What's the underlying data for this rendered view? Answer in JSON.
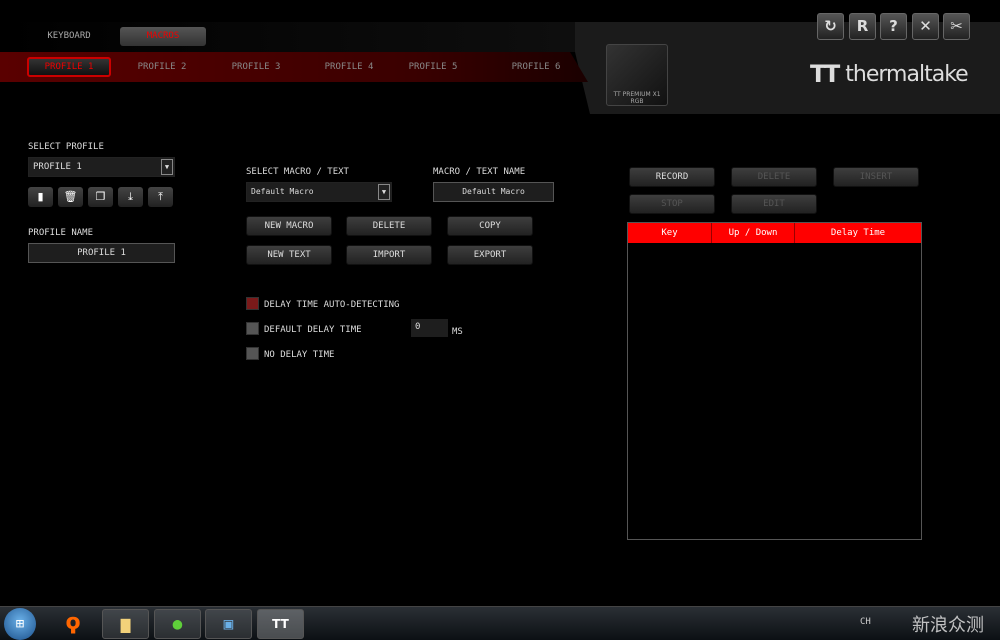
{
  "tabs": [
    {
      "label": "KEYBOARD",
      "active": false
    },
    {
      "label": "MACROS",
      "active": true
    }
  ],
  "profile_tabs": [
    "PROFILE 1",
    "PROFILE 2",
    "PROFILE 3",
    "PROFILE 4",
    "PROFILE 5",
    "PROFILE 6"
  ],
  "active_profile_tab": 0,
  "window_buttons": [
    {
      "icon": "refresh-icon",
      "glyph": "↻"
    },
    {
      "icon": "reset-icon",
      "glyph": "R"
    },
    {
      "icon": "help-icon",
      "glyph": "?"
    },
    {
      "icon": "close-icon",
      "glyph": "✕"
    },
    {
      "icon": "tools-icon",
      "glyph": "✂"
    }
  ],
  "device": {
    "name": "TT PREMIUM X1 RGB"
  },
  "brand": {
    "logo": "thermaltake"
  },
  "profile": {
    "select_label": "SELECT PROFILE",
    "selected": "PROFILE 1",
    "name_label": "PROFILE NAME",
    "name_value": "PROFILE 1",
    "actions": [
      {
        "icon": "new-icon",
        "glyph": "▮"
      },
      {
        "icon": "trash-icon",
        "glyph": "🗑"
      },
      {
        "icon": "copy-icon",
        "glyph": "❐"
      },
      {
        "icon": "import-icon",
        "glyph": "⤓"
      },
      {
        "icon": "export-icon",
        "glyph": "⤒"
      }
    ]
  },
  "macro": {
    "select_label": "SELECT MACRO / TEXT",
    "selected": "Default Macro",
    "name_label": "MACRO / TEXT NAME",
    "name_value": "Default Macro",
    "buttons": [
      "NEW MACRO",
      "DELETE",
      "COPY",
      "NEW TEXT",
      "IMPORT",
      "EXPORT"
    ],
    "options": [
      {
        "label": "DELAY TIME AUTO-DETECTING",
        "checked": true
      },
      {
        "label": "DEFAULT DELAY TIME",
        "checked": false
      },
      {
        "label": "NO DELAY TIME",
        "checked": false
      }
    ],
    "delay_value": "0",
    "delay_unit": "MS"
  },
  "record": {
    "buttons": [
      {
        "label": "RECORD",
        "enabled": true
      },
      {
        "label": "DELETE",
        "enabled": false
      },
      {
        "label": "INSERT",
        "enabled": false
      },
      {
        "label": "STOP",
        "enabled": false
      },
      {
        "label": "EDIT",
        "enabled": false
      }
    ],
    "columns": [
      "Key",
      "Up / Down",
      "Delay Time"
    ],
    "rows": []
  },
  "taskbar": {
    "lang": "CH",
    "watermark": "新浪众测"
  },
  "colors": {
    "accent": "#ff0000",
    "profile_strip": "#5a0000"
  }
}
